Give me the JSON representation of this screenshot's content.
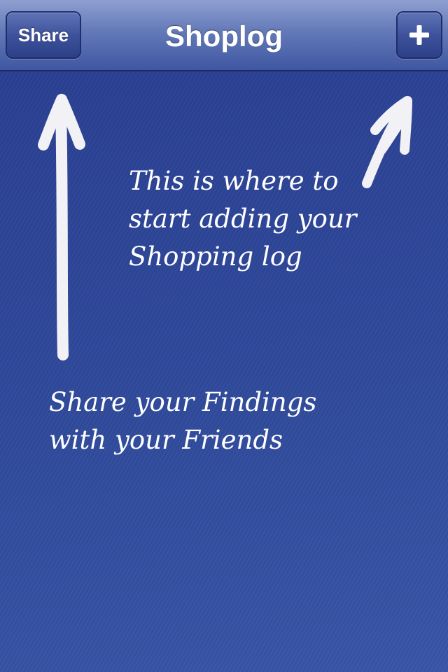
{
  "navbar": {
    "title": "Shoplog",
    "share_label": "Share",
    "add_icon": "plus-icon"
  },
  "hints": {
    "add_lines": [
      "This is where to",
      "start adding your",
      "Shopping log"
    ],
    "share_lines": [
      "Share your Findings",
      "with your Friends"
    ]
  },
  "colors": {
    "background": "#2f4799",
    "navbar": "#6379b8",
    "text": "#ffffff",
    "arrow": "#f2f2f6"
  }
}
